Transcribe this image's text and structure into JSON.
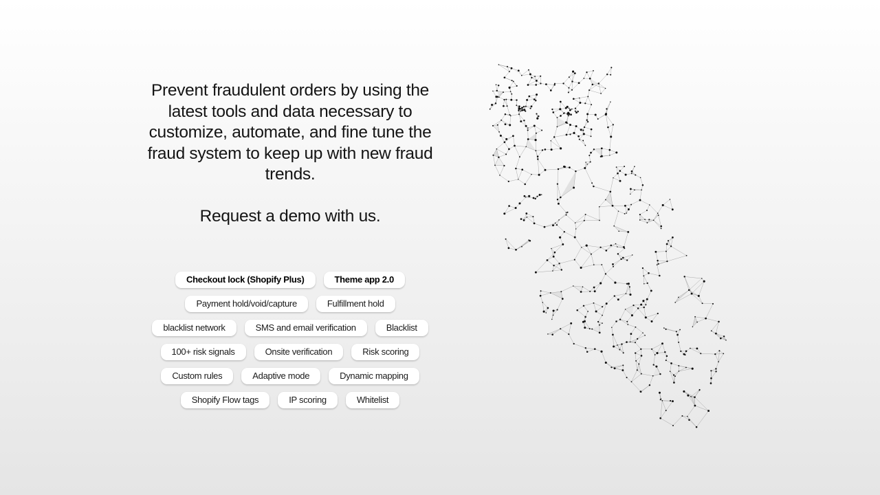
{
  "headline": "Prevent fraudulent orders by using the latest tools and data necessary to customize, automate, and fine tune the fraud system to keep up with new fraud trends.",
  "cta": "Request a demo with us.",
  "features": {
    "rows": [
      [
        {
          "label": "Checkout lock (Shopify Plus)",
          "bold": true
        },
        {
          "label": "Theme app 2.0",
          "bold": true
        }
      ],
      [
        {
          "label": "Payment hold/void/capture",
          "bold": false
        },
        {
          "label": "Fulfillment hold",
          "bold": false
        }
      ],
      [
        {
          "label": "blacklist network",
          "bold": false
        },
        {
          "label": "SMS and email verification",
          "bold": false
        },
        {
          "label": "Blacklist",
          "bold": false
        }
      ],
      [
        {
          "label": "100+ risk signals",
          "bold": false
        },
        {
          "label": "Onsite verification",
          "bold": false
        },
        {
          "label": "Risk scoring",
          "bold": false
        }
      ],
      [
        {
          "label": "Custom rules",
          "bold": false
        },
        {
          "label": "Adaptive mode",
          "bold": false
        },
        {
          "label": "Dynamic mapping",
          "bold": false
        }
      ],
      [
        {
          "label": "Shopify Flow tags",
          "bold": false
        },
        {
          "label": "IP scoring",
          "bold": false
        },
        {
          "label": "Whitelist",
          "bold": false
        }
      ]
    ]
  },
  "illustration": {
    "icon": "owl-polygon-network-icon",
    "colors": {
      "node": "#111111",
      "line": "#8a8a8a",
      "facet": "#9a9a9a"
    }
  }
}
